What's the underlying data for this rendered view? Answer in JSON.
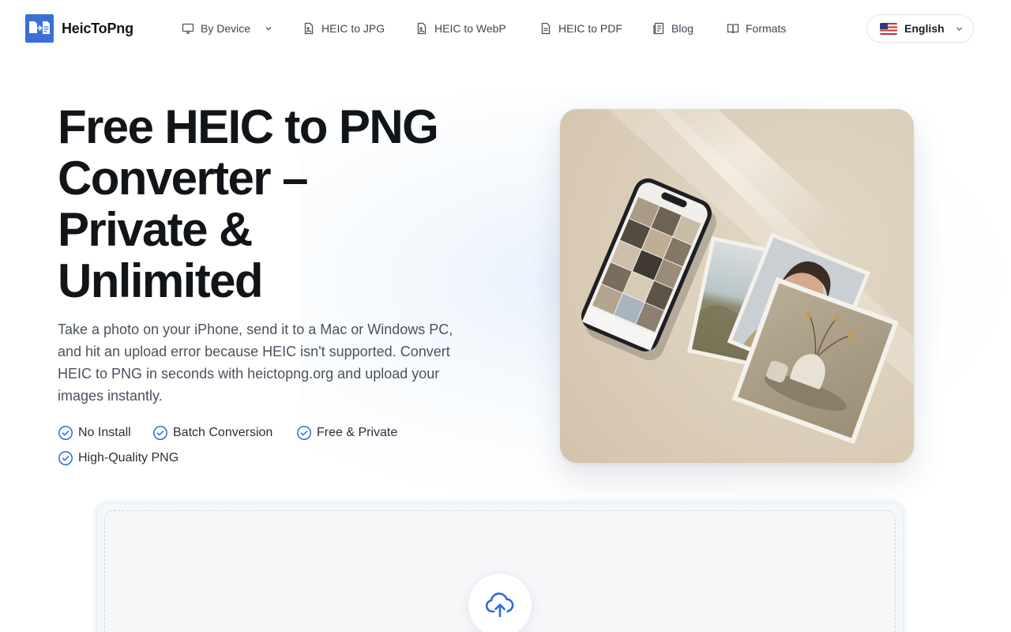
{
  "brand": {
    "name": "HeicToPng",
    "accent": "#3b6fd8",
    "logo_icon": "file-convert-icon"
  },
  "nav": [
    {
      "label": "By Device",
      "icon": "monitor-icon",
      "has_dropdown": true
    },
    {
      "label": "HEIC to JPG",
      "icon": "image-file-icon"
    },
    {
      "label": "HEIC to WebP",
      "icon": "image-file-icon"
    },
    {
      "label": "HEIC to PDF",
      "icon": "document-icon"
    },
    {
      "label": "Blog",
      "icon": "newspaper-icon"
    },
    {
      "label": "Formats",
      "icon": "book-open-icon"
    }
  ],
  "language": {
    "label": "English",
    "flag": "us-flag-icon"
  },
  "hero": {
    "title_lines": [
      "Free HEIC to PNG",
      "Converter –",
      "Private &",
      "Unlimited"
    ],
    "description": "Take a photo on your iPhone, send it to a Mac or Windows PC, and hit an upload error because HEIC isn't supported. Convert HEIC to PNG in seconds with heictopng.org and upload your images instantly.",
    "features": [
      "No Install",
      "Batch Conversion",
      "Free & Private",
      "High-Quality PNG"
    ],
    "feature_icon": "check-circle-icon",
    "check_color": "#2d6cdf"
  },
  "upload": {
    "icon": "cloud-upload-icon",
    "icon_color": "#2d6cdf"
  }
}
